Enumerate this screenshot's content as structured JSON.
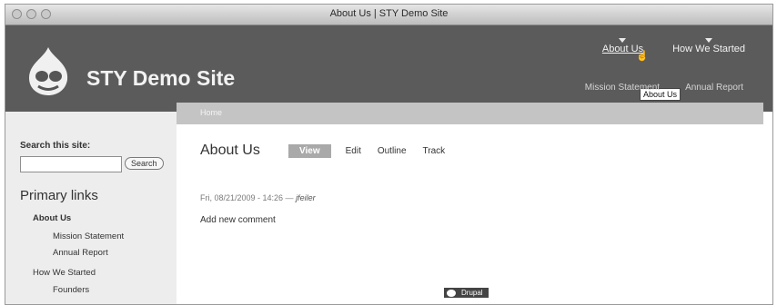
{
  "window": {
    "title": "About Us | STY Demo Site"
  },
  "site": {
    "name": "STY Demo Site"
  },
  "primary_nav": [
    {
      "label": "About Us"
    },
    {
      "label": "How We Started"
    }
  ],
  "tooltip": "About Us",
  "secondary_nav": [
    {
      "label": "Mission Statement"
    },
    {
      "label": "Annual Report"
    }
  ],
  "sidebar": {
    "search_label": "Search this site:",
    "search_value": "",
    "search_button": "Search",
    "menu_title": "Primary links",
    "menu_items": [
      {
        "label": "About Us"
      },
      {
        "label": "Mission Statement"
      },
      {
        "label": "Annual Report"
      },
      {
        "label": "How We Started"
      },
      {
        "label": "Founders"
      }
    ]
  },
  "main": {
    "breadcrumb": "Home",
    "title": "About Us",
    "tabs": [
      {
        "label": "View"
      },
      {
        "label": "Edit"
      },
      {
        "label": "Outline"
      },
      {
        "label": "Track"
      }
    ],
    "submitted_date": "Fri, 08/21/2009 - 14:26 — ",
    "submitted_author": "jfeiler",
    "add_comment": "Add new comment",
    "footer_badge": "Drupal"
  }
}
